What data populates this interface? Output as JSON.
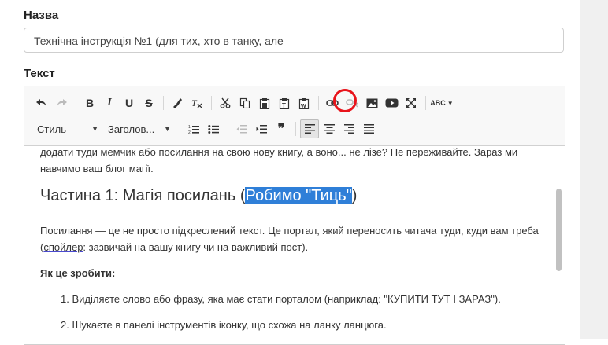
{
  "form": {
    "title_label": "Назва",
    "title_value": "Технічна інструкція №1 (для тих, хто в танку, але",
    "text_label": "Текст"
  },
  "toolbar": {
    "row1": [
      {
        "icon": "undo-icon"
      },
      {
        "icon": "redo-icon",
        "disabled": true
      },
      {
        "icon": "bold-icon",
        "glyph": "B"
      },
      {
        "icon": "italic-icon",
        "glyph": "I"
      },
      {
        "icon": "underline-icon",
        "glyph": "U"
      },
      {
        "icon": "strikethrough-icon",
        "glyph": "S"
      },
      {
        "icon": "copy-formatting-icon"
      },
      {
        "icon": "remove-format-icon"
      },
      {
        "icon": "cut-icon"
      },
      {
        "icon": "copy-icon"
      },
      {
        "icon": "paste-icon"
      },
      {
        "icon": "paste-text-icon"
      },
      {
        "icon": "paste-word-icon"
      },
      {
        "icon": "link-icon"
      },
      {
        "icon": "unlink-icon",
        "disabled": true
      },
      {
        "icon": "image-icon"
      },
      {
        "icon": "youtube-icon"
      },
      {
        "icon": "maximize-icon"
      },
      {
        "icon": "spellcheck-icon",
        "glyph": "ABC"
      }
    ],
    "style_combo": "Стиль",
    "heading_combo": "Заголов...",
    "row2": [
      {
        "icon": "numbered-list-icon"
      },
      {
        "icon": "bulleted-list-icon"
      },
      {
        "icon": "decrease-indent-icon",
        "disabled": true
      },
      {
        "icon": "increase-indent-icon"
      },
      {
        "icon": "blockquote-icon",
        "glyph": "99"
      },
      {
        "icon": "align-left-icon",
        "active": true
      },
      {
        "icon": "align-center-icon"
      },
      {
        "icon": "align-right-icon"
      },
      {
        "icon": "justify-icon"
      }
    ],
    "highlight_color": "#e8141b"
  },
  "content": {
    "intro": "додати туди мемчик або посилання на свою нову книгу, а воно... не лізе? Не переживайте. Зараз ми навчимо ваш блог магії.",
    "heading_prefix": "Частина 1: Магія посилань (",
    "heading_selected": "Робимо \"Тиць\"",
    "heading_suffix": ")",
    "body_part1": "Посилання — це не просто підкреслений текст. Це портал, який переносить читача туди, куди вам треба (",
    "body_spoiler": "спойлер",
    "body_part2": ": зазвичай на вашу книгу чи на важливий пост).",
    "how_heading": "Як це зробити:",
    "steps": [
      "1. Виділяєте слово або фразу, яка має стати порталом (наприклад: \"КУПИТИ ТУТ І ЗАРАЗ\").",
      "2. Шукаєте в панелі інструментів іконку, що схожа на ланку ланцюга."
    ]
  },
  "selection_color": "#2f7fd8"
}
